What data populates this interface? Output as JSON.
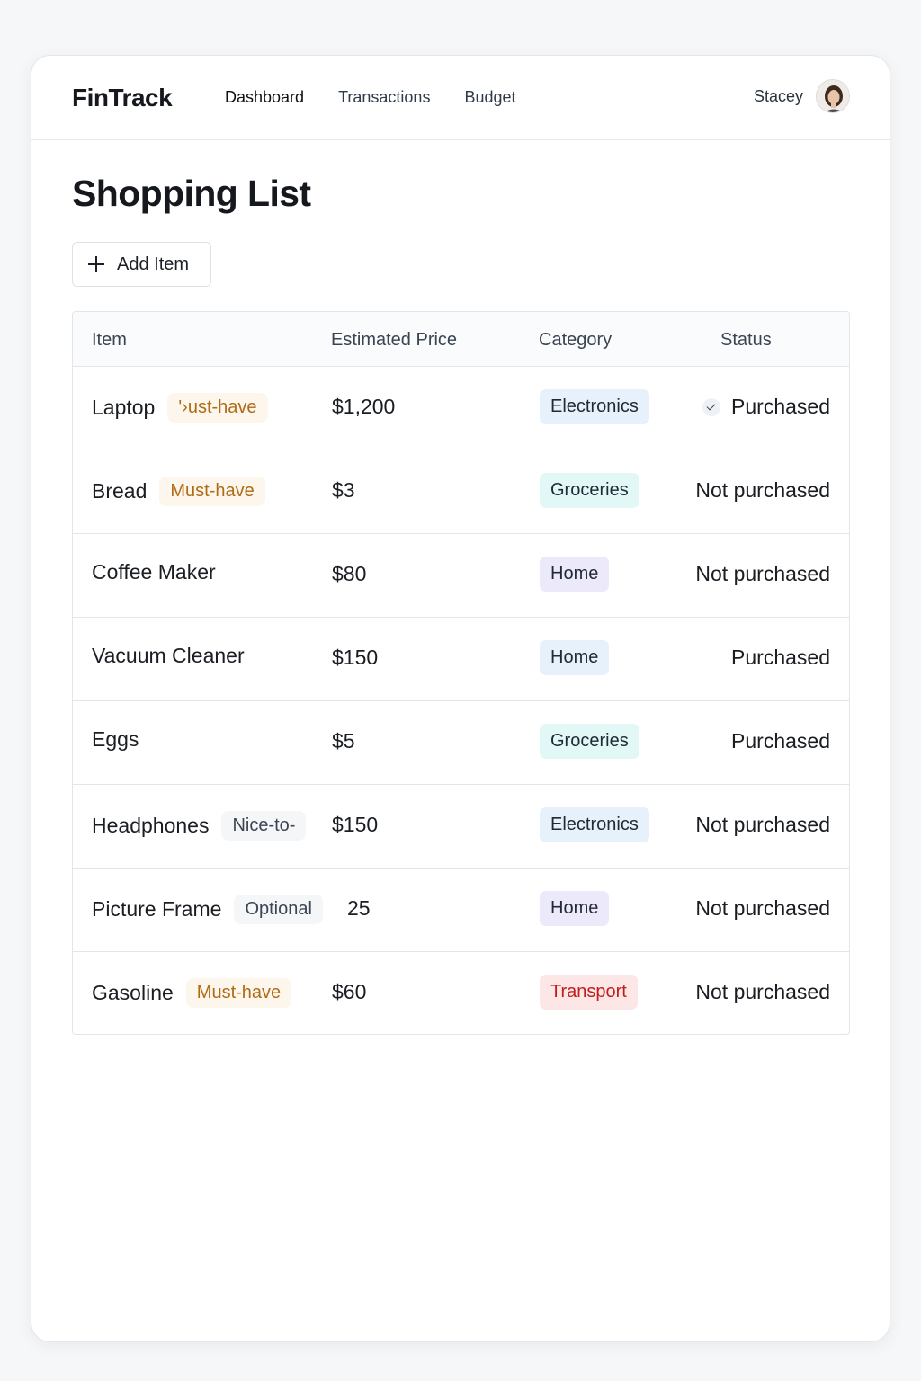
{
  "app": {
    "brand": "FinTrack",
    "nav": [
      "Dashboard",
      "Transactions",
      "Budget"
    ],
    "user_name": "Stacey"
  },
  "page": {
    "title": "Shopping List",
    "add_button_label": "Add Item"
  },
  "table": {
    "columns": [
      "Item",
      "Estimated Price",
      "Category",
      "Status"
    ],
    "rows": [
      {
        "item": "Laptop",
        "priority": "'›ust-have",
        "price": "$1,200",
        "category": "Electronics",
        "status": "Purchased",
        "check": true
      },
      {
        "item": "Bread",
        "priority": "Must-have",
        "price": "$3",
        "category": "Groceries",
        "status": "Not purchased",
        "check": false
      },
      {
        "item": "Coffee Maker",
        "priority": "",
        "price": "$80",
        "category": "Home",
        "status": "Not purchased",
        "check": false
      },
      {
        "item": "Vacuum Cleaner",
        "priority": "",
        "price": "$150",
        "category": "Home",
        "status": "Purchased",
        "check": false
      },
      {
        "item": "Eggs",
        "priority": "",
        "price": "$5",
        "category": "Groceries",
        "status": "Purchased",
        "check": false
      },
      {
        "item": "Headphones",
        "priority": "Nice-to-",
        "price": "$150",
        "category": "Electronics",
        "status": "Not purchased",
        "check": false
      },
      {
        "item": "Picture Frame",
        "priority": "Optional",
        "price": "25",
        "category": "Home",
        "status": "Not purchased",
        "check": false
      },
      {
        "item": "Gasoline",
        "priority": "Must-have",
        "price": "$60",
        "category": "Transport",
        "status": "Not purchased",
        "check": false
      }
    ]
  },
  "colors": {
    "Electronics": {
      "bg": "#e6f1fb",
      "fg": "#1f2a36"
    },
    "Groceries": {
      "bg": "#e2f8f7",
      "fg": "#1f2a36"
    },
    "Home_a": {
      "bg": "#ece9fb",
      "fg": "#1f2a36"
    },
    "Home_b": {
      "bg": "#e6f1fb",
      "fg": "#1f2a36"
    },
    "Transport": {
      "bg": "#fde6e6",
      "fg": "#c21d1d"
    }
  }
}
